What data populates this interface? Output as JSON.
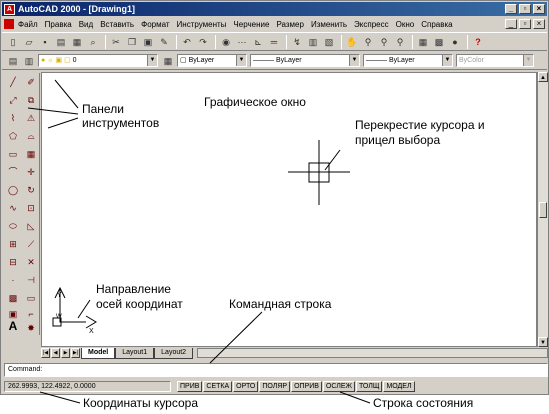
{
  "window": {
    "title": "AutoCAD 2000 - [Drawing1]",
    "caption_buttons": [
      "_",
      "▫",
      "×"
    ],
    "doc_buttons": [
      "_",
      "▫",
      "×"
    ]
  },
  "menu": [
    {
      "label": "Файл"
    },
    {
      "label": "Правка"
    },
    {
      "label": "Вид"
    },
    {
      "label": "Вставить"
    },
    {
      "label": "Формат"
    },
    {
      "label": "Инструменты"
    },
    {
      "label": "Черчение"
    },
    {
      "label": "Размер"
    },
    {
      "label": "Изменить"
    },
    {
      "label": "Экспресс"
    },
    {
      "label": "Окно"
    },
    {
      "label": "Справка"
    }
  ],
  "properties": {
    "layer": "0",
    "color": "ByLayer",
    "linetype": "ByLayer",
    "lineweight": "ByLayer",
    "plotstyle": "ByColor"
  },
  "layout_tabs": [
    {
      "label": "Model",
      "active": true
    },
    {
      "label": "Layout1",
      "active": false
    },
    {
      "label": "Layout2",
      "active": false
    }
  ],
  "command_line": {
    "text": "Command:"
  },
  "status": {
    "coordinates": "262.9993, 122.4922, 0.0000",
    "buttons": [
      "ПРИВ",
      "СЕТКА",
      "ОРТО",
      "ПОЛЯР",
      "ОПРИВ",
      "ОСЛЕЖ",
      "ТОЛЩ",
      "МОДЕЛ"
    ]
  },
  "annotations": {
    "toolbars": "Панели\nинструментов",
    "graphic_window": "Графическое окно",
    "crosshair": "Перекрестие курсора и\nприцел выбора",
    "axes_direction": "Направление\nосей координат",
    "command_line": "Командная строка",
    "cursor_coords": "Координаты курсора",
    "status_line": "Строка состояния"
  },
  "ucs_icon": {
    "x_label": "X",
    "y_label": "Y",
    "w_label": "W"
  }
}
